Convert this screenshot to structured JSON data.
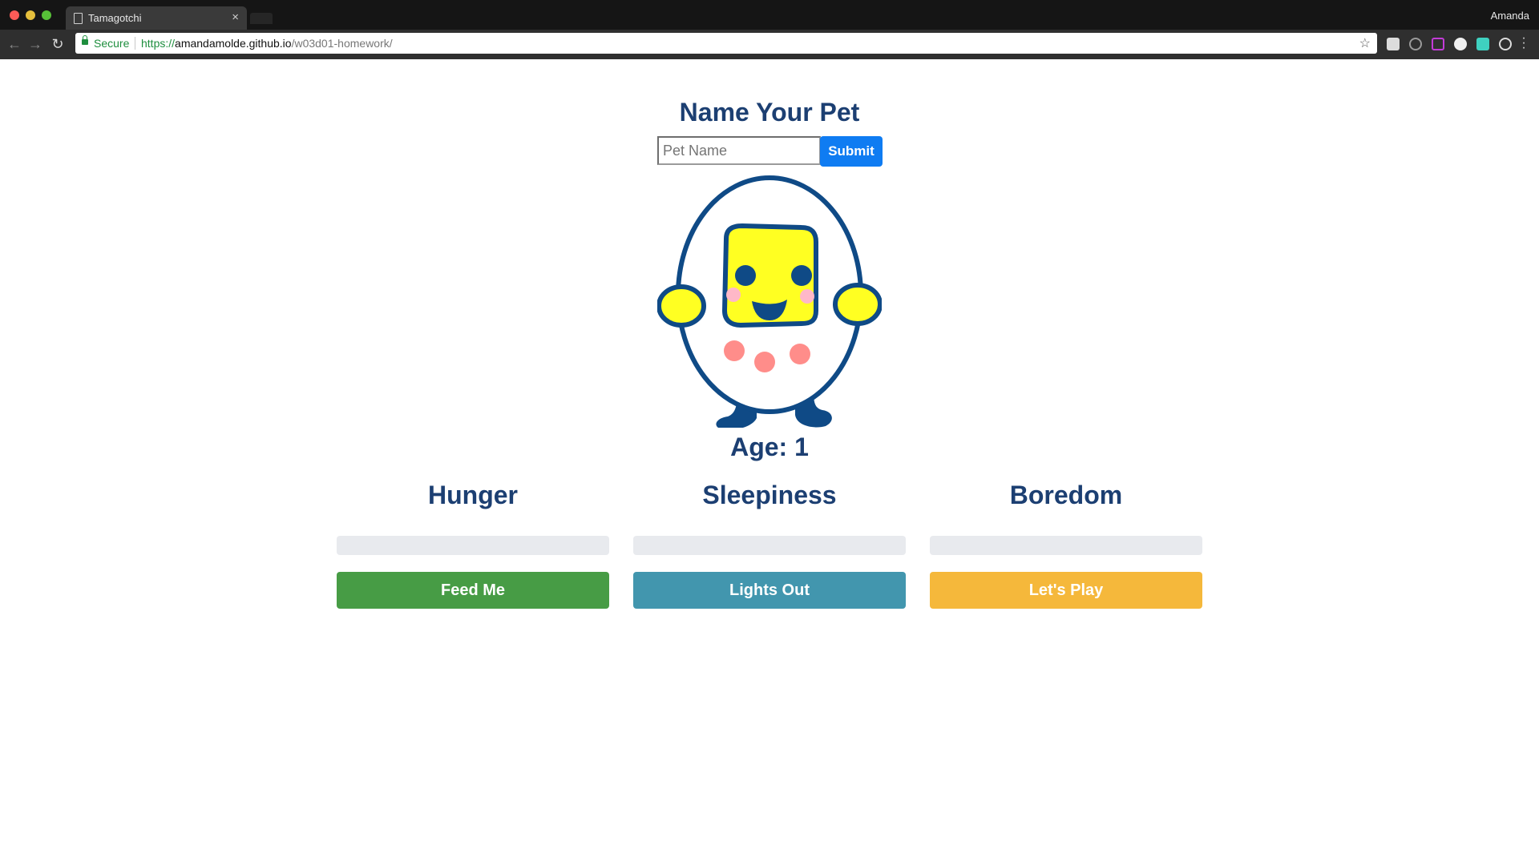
{
  "browser": {
    "tab_title": "Tamagotchi",
    "profile_name": "Amanda",
    "secure_label": "Secure",
    "url": {
      "scheme": "https://",
      "host": "amandamolde.github.io",
      "path": "/w03d01-homework/"
    }
  },
  "page": {
    "name_heading": "Name Your Pet",
    "pet_name_placeholder": "Pet Name",
    "pet_name_value": "",
    "submit_label": "Submit",
    "age_text": "Age: 1"
  },
  "stats": [
    {
      "title": "Hunger",
      "level": 0,
      "button_label": "Feed Me",
      "button_color": "#479c45"
    },
    {
      "title": "Sleepiness",
      "level": 0,
      "button_label": "Lights Out",
      "button_color": "#4296ae"
    },
    {
      "title": "Boredom",
      "level": 0,
      "button_label": "Let's Play",
      "button_color": "#f5b83b"
    }
  ],
  "colors": {
    "heading": "#1c3f72",
    "submit": "#0f7cf2",
    "progress_track": "#e8eaee",
    "pet_outline": "#0f4a86",
    "pet_face": "#ffff22",
    "pet_spots": "#ff8d8a",
    "pet_cheeks": "#ffb8c8"
  }
}
